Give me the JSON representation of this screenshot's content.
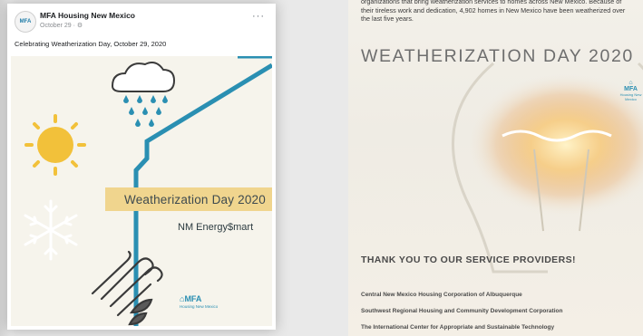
{
  "post": {
    "page_name": "MFA Housing New Mexico",
    "meta": "October 29 · ⚙",
    "more_label": "···",
    "caption": "Celebrating Weatherization Day, October 29, 2020",
    "avatar_text": "MFA",
    "image": {
      "banner": "Weatherization Day 2020",
      "energy": "NM Energy$mart",
      "logo": "MFA",
      "logo_sub": "Housing New Mexico"
    }
  },
  "poster": {
    "intro": "organizations that bring weatherization services to homes across New Mexico. Because of their tireless work and dedication, 4,902 homes in New Mexico have been weatherized over the last five years.",
    "title": "WEATHERIZATION DAY 2020",
    "logo": "MFA",
    "logo_sub": "Housing New Mexico",
    "thanks": "THANK YOU TO OUR SERVICE PROVIDERS!",
    "providers": [
      "Central New Mexico Housing Corporation of Albuquerque",
      "Southwest Regional Housing and Community Development Corporation",
      "The International Center for Appropriate and Sustainable Technology"
    ]
  },
  "colors": {
    "accent_teal": "#2a8fb2",
    "banner_yellow": "#f0d58e",
    "sun_yellow": "#f2c13a",
    "background": "#e9e9e9"
  },
  "icons": [
    "cloud-rain-icon",
    "sun-icon",
    "snowflake-icon",
    "wind-icon",
    "lightbulb-icon"
  ]
}
